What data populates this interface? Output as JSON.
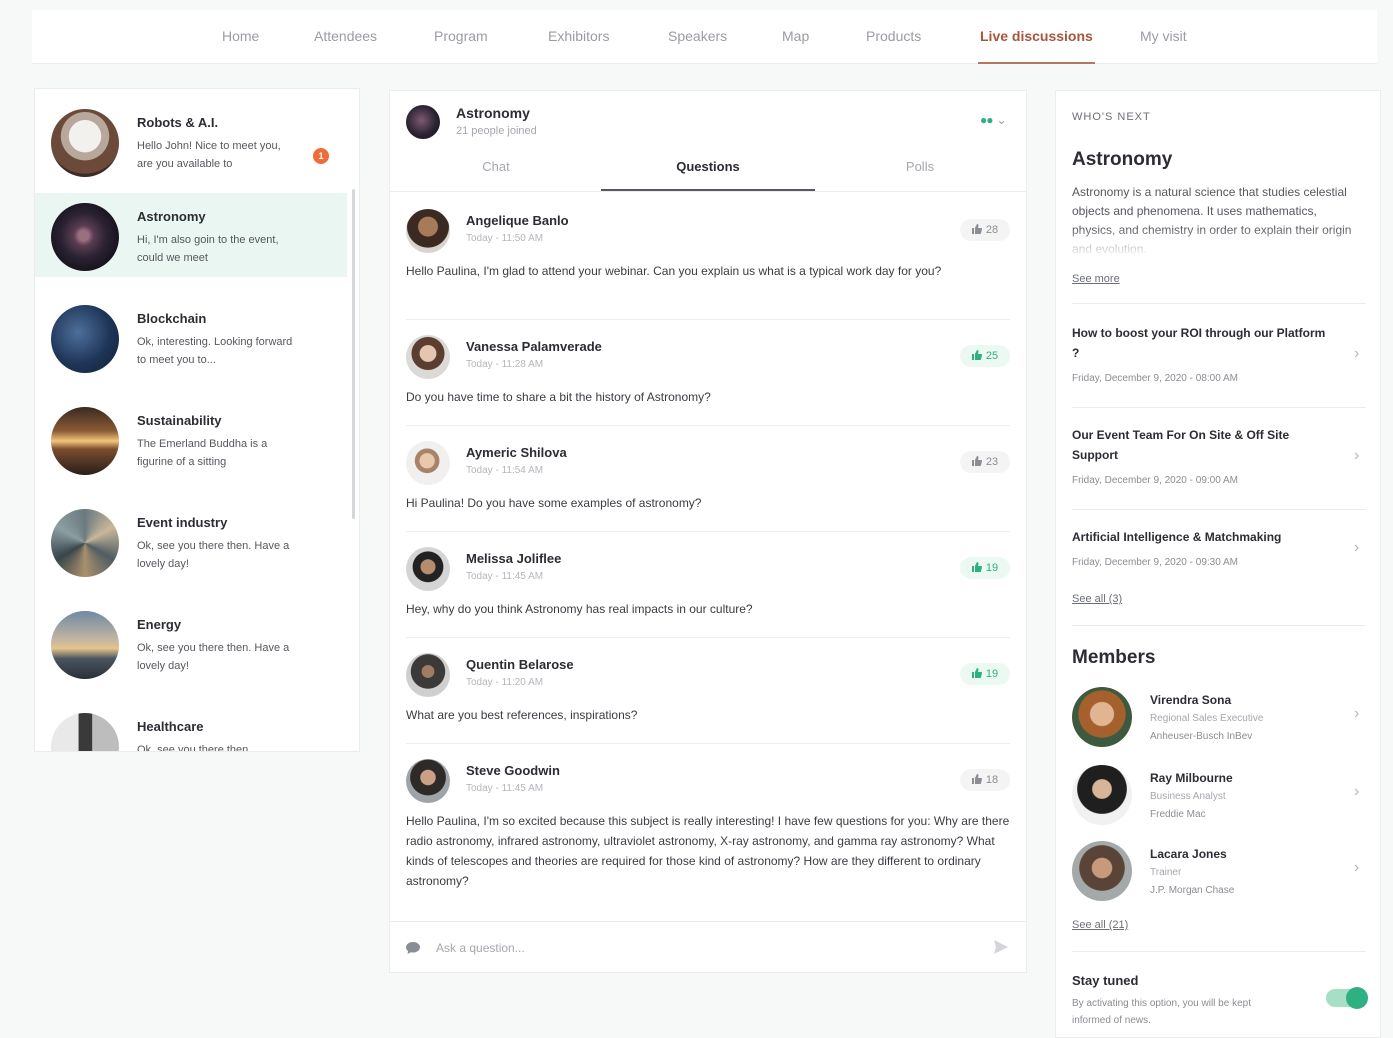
{
  "nav": {
    "items": [
      "Home",
      "Attendees",
      "Program",
      "Exhibitors",
      "Speakers",
      "Map",
      "Products",
      "Live discussions",
      "My visit"
    ],
    "active": "Live discussions"
  },
  "rooms": [
    {
      "title": "Robots & A.I.",
      "preview": "Hello John! Nice to meet you, are you available to",
      "badge": "1"
    },
    {
      "title": "Astronomy",
      "preview": "Hi, I'm also goin to the event, could we meet"
    },
    {
      "title": "Blockchain",
      "preview": "Ok, interesting. Looking forward to meet you to..."
    },
    {
      "title": "Sustainability",
      "preview": "The Emerland Buddha is a figurine of a sitting"
    },
    {
      "title": "Event industry",
      "preview": "Ok, see you there then. Have a lovely day!"
    },
    {
      "title": "Energy",
      "preview": "Ok, see you there then. Have a lovely day!"
    },
    {
      "title": "Healthcare",
      "preview": "Ok, see you there then."
    }
  ],
  "channel": {
    "title": "Astronomy",
    "subtitle": "21 people joined",
    "tabs": [
      "Chat",
      "Questions",
      "Polls"
    ],
    "active_tab": "Questions",
    "ask_placeholder": "Ask a question..."
  },
  "questions": [
    {
      "name": "Angelique Banlo",
      "time": "Today - 11:50 AM",
      "likes": "28",
      "liked": false,
      "text": "Hello Paulina, I'm glad to attend your webinar. Can you explain us what is a typical work day for you?"
    },
    {
      "name": "Vanessa Palamverade",
      "time": "Today - 11:28 AM",
      "likes": "25",
      "liked": true,
      "text": "Do you have time to share a bit the history of Astronomy?"
    },
    {
      "name": "Aymeric Shilova",
      "time": "Today - 11:54 AM",
      "likes": "23",
      "liked": false,
      "text": "Hi Paulina! Do you have some examples of astronomy?"
    },
    {
      "name": "Melissa Joliflee",
      "time": "Today - 11:45 AM",
      "likes": "19",
      "liked": true,
      "text": "Hey, why do you think Astronomy has real impacts in our culture?"
    },
    {
      "name": "Quentin Belarose",
      "time": "Today - 11:20 AM",
      "likes": "19",
      "liked": true,
      "text": "What are you best references, inspirations?"
    },
    {
      "name": "Steve Goodwin",
      "time": "Today - 11:45 AM",
      "likes": "18",
      "liked": false,
      "text": "Hello Paulina, I'm so excited because this subject is really interesting! I have few questions for you: Why are there radio astronomy, infrared astronomy, ultraviolet astronomy, X-ray astronomy, and gamma ray astronomy? What kinds of telescopes and theories are required for those kind of astronomy? How are they different to ordinary astronomy?"
    }
  ],
  "whos_next": {
    "label": "WHO'S NEXT",
    "title": "Astronomy",
    "description": "Astronomy is a natural science that studies celestial objects and phenomena. It uses mathematics, physics, and chemistry in order to explain their origin and evolution.",
    "see_more": "See more",
    "sessions": [
      {
        "title": "How to boost your ROI through our Platform ?",
        "date": "Friday, December 9, 2020 - 08:00 AM"
      },
      {
        "title": "Our Event Team For On Site & Off Site Support",
        "date": "Friday, December 9, 2020 - 09:00 AM"
      },
      {
        "title": "Artificial Intelligence & Matchmaking",
        "date": "Friday, December 9, 2020 - 09:30 AM"
      }
    ],
    "see_all": "See all (3)"
  },
  "members": {
    "title": "Members",
    "list": [
      {
        "name": "Virendra Sona",
        "role": "Regional Sales Executive",
        "company": "Anheuser-Busch InBev"
      },
      {
        "name": "Ray Milbourne",
        "role": "Business Analyst",
        "company": "Freddie Mac"
      },
      {
        "name": "Lacara Jones",
        "role": "Trainer",
        "company": "J.P. Morgan Chase"
      }
    ],
    "see_all": "See all (21)"
  },
  "stay_tuned": {
    "title": "Stay tuned",
    "description": "By activating this option, you will be kept informed of news.",
    "enabled": true
  },
  "colors": {
    "accent": "#2fb082",
    "active_nav": "#a8553e",
    "badge": "#ee6b3b",
    "room_active_bg": "#eaf6f1"
  }
}
